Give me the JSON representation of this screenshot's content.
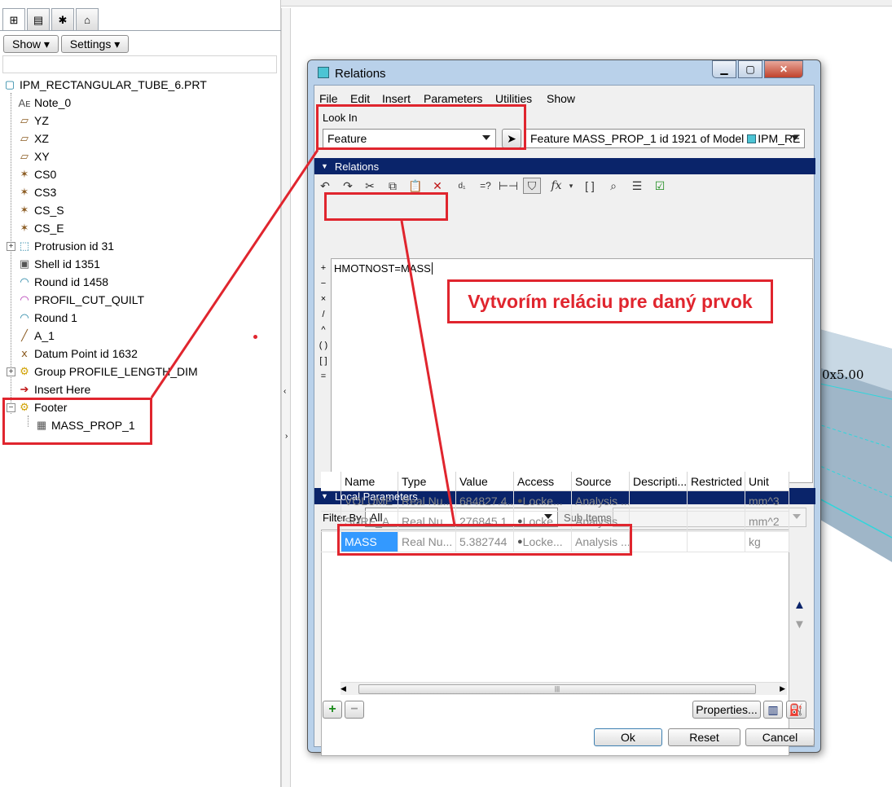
{
  "model_tree": {
    "show_label": "Show",
    "settings_label": "Settings",
    "items": [
      {
        "label": "IPM_RECTANGULAR_TUBE_6.PRT",
        "icon": "part-icon"
      },
      {
        "label": "Note_0",
        "icon": "note-icon"
      },
      {
        "label": "YZ",
        "icon": "datum-plane-icon"
      },
      {
        "label": "XZ",
        "icon": "datum-plane-icon"
      },
      {
        "label": "XY",
        "icon": "datum-plane-icon"
      },
      {
        "label": "CS0",
        "icon": "coordinate-system-icon"
      },
      {
        "label": "CS3",
        "icon": "coordinate-system-icon"
      },
      {
        "label": "CS_S",
        "icon": "coordinate-system-icon"
      },
      {
        "label": "CS_E",
        "icon": "coordinate-system-icon"
      },
      {
        "label": "Protrusion id 31",
        "icon": "protrusion-icon"
      },
      {
        "label": "Shell id 1351",
        "icon": "shell-icon"
      },
      {
        "label": "Round id 1458",
        "icon": "round-icon"
      },
      {
        "label": "PROFIL_CUT_QUILT",
        "icon": "quilt-icon"
      },
      {
        "label": "Round 1",
        "icon": "round-icon"
      },
      {
        "label": "A_1",
        "icon": "datum-axis-icon"
      },
      {
        "label": "Datum Point id 1632",
        "icon": "datum-point-icon"
      },
      {
        "label": "Group PROFILE_LENGTH_DIM",
        "icon": "group-icon"
      },
      {
        "label": "Insert Here",
        "icon": "insert-arrow-icon"
      },
      {
        "label": "Footer",
        "icon": "group-icon"
      },
      {
        "label": "MASS_PROP_1",
        "icon": "analysis-icon"
      }
    ]
  },
  "graphics": {
    "dimension_text": "0x5.00"
  },
  "dialog": {
    "title": "Relations",
    "menu": [
      "File",
      "Edit",
      "Insert",
      "Parameters",
      "Utilities",
      "Show"
    ],
    "look_in_label": "Look In",
    "look_in_value": "Feature",
    "feature_info": "Feature MASS_PROP_1 id 1921 of Model",
    "model_name": "IPM_RE",
    "relations_section": "Relations",
    "relation_text": "HMOTNOST=MASS",
    "operators": [
      "+",
      "−",
      "×",
      "/",
      "^",
      "( )",
      "[ ]",
      "="
    ],
    "local_params_section": "Local Parameters",
    "filter_by_label": "Filter By",
    "filter_by_value": "All",
    "sub_items_label": "Sub Items",
    "columns": [
      "Name",
      "Type",
      "Value",
      "Access",
      "Source",
      "Descripti...",
      "Restricted",
      "Unit"
    ],
    "rows": [
      {
        "name": "VOLUME",
        "type": "Real Nu...",
        "value": "684827.4...",
        "access": "Locke...",
        "source": "Analysis ...",
        "description": "",
        "restricted": "",
        "unit": "mm^3"
      },
      {
        "name": "SURF_A...",
        "type": "Real Nu...",
        "value": "276845.1...",
        "access": "Locke...",
        "source": "Analysis ...",
        "description": "",
        "restricted": "",
        "unit": "mm^2"
      },
      {
        "name": "MASS",
        "type": "Real Nu...",
        "value": "5.382744",
        "access": "Locke...",
        "source": "Analysis ...",
        "description": "",
        "restricted": "",
        "unit": "kg"
      }
    ],
    "properties_label": "Properties...",
    "ok_label": "Ok",
    "reset_label": "Reset",
    "cancel_label": "Cancel"
  },
  "annotation": {
    "callout_text": "Vytvorím reláciu pre daný prvok"
  }
}
